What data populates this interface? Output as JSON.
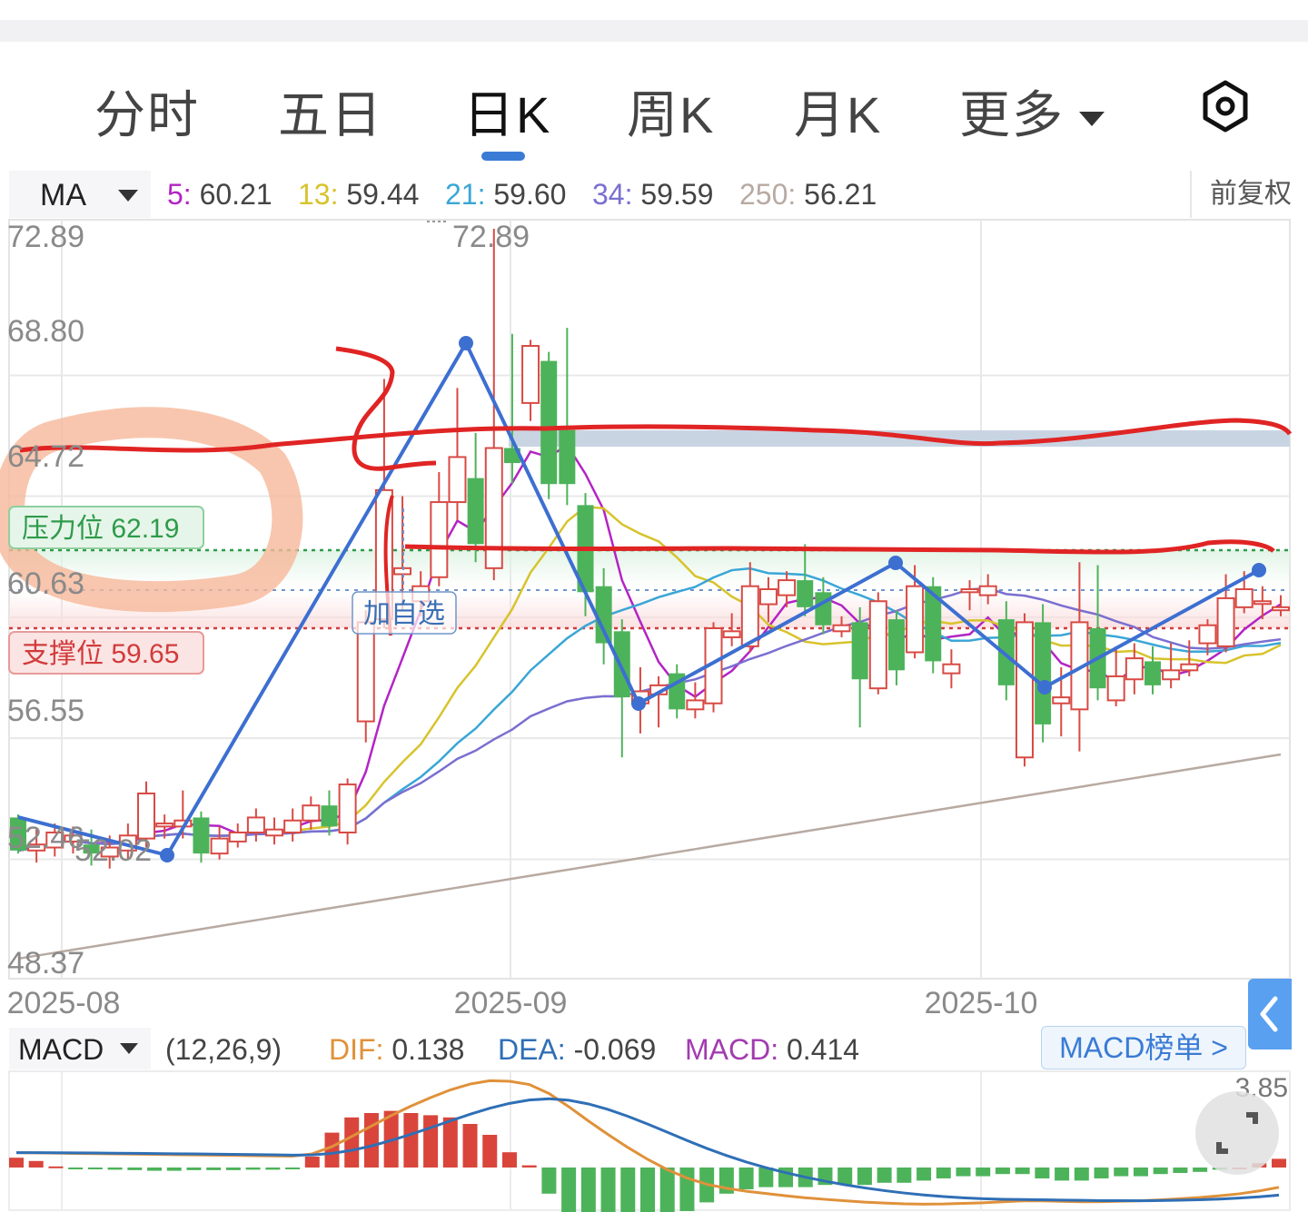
{
  "tabs": [
    {
      "label": "分时"
    },
    {
      "label": "五日"
    },
    {
      "label": "日K",
      "active": true
    },
    {
      "label": "周K"
    },
    {
      "label": "月K"
    },
    {
      "label": "更多"
    }
  ],
  "settings_icon": "hexagon-gear-icon",
  "ma_legend": {
    "label": "MA",
    "items": [
      {
        "key": "5",
        "value": "60.21",
        "color": "#b324c4"
      },
      {
        "key": "13",
        "value": "59.44",
        "color": "#d8c32c"
      },
      {
        "key": "21",
        "value": "59.60",
        "color": "#3aa6d6"
      },
      {
        "key": "34",
        "value": "59.59",
        "color": "#7a6fd0"
      },
      {
        "key": "250",
        "value": "56.21",
        "color": "#b8aaa2"
      }
    ],
    "adjust_label": "前复权"
  },
  "chart_data": {
    "type": "candlestick",
    "y_range": [
      48.37,
      72.89
    ],
    "y_ticks": [
      "72.89",
      "68.80",
      "64.72",
      "60.63",
      "56.55",
      "52.46",
      "48.37"
    ],
    "x_ticks": [
      "2025-08",
      "2025-09",
      "2025-10"
    ],
    "max_label": "72.89",
    "min_label": "52.02",
    "resistance": {
      "label": "压力位 62.19",
      "value": 62.19,
      "color": "#2e9b4a"
    },
    "support": {
      "label": "支撑位 59.65",
      "value": 59.65,
      "color": "#d23b3b"
    },
    "current_price": 60.63,
    "watchlist_label": "加自选",
    "candles": [
      [
        53.3,
        52.2,
        53.4,
        52.1
      ],
      [
        52.2,
        52.4,
        52.9,
        51.8
      ],
      [
        52.3,
        52.8,
        53.1,
        52.0
      ],
      [
        52.5,
        52.7,
        53.0,
        52.1
      ],
      [
        52.4,
        52.1,
        52.9,
        51.7
      ],
      [
        52.0,
        52.3,
        52.7,
        51.6
      ],
      [
        52.2,
        52.7,
        53.1,
        51.9
      ],
      [
        52.6,
        54.1,
        54.5,
        52.3
      ],
      [
        53.0,
        53.1,
        53.4,
        52.6
      ],
      [
        53.0,
        53.2,
        54.2,
        52.6
      ],
      [
        53.3,
        52.1,
        53.5,
        51.8
      ],
      [
        52.1,
        52.6,
        53.0,
        51.9
      ],
      [
        52.5,
        52.8,
        53.1,
        52.3
      ],
      [
        52.8,
        53.3,
        53.6,
        52.5
      ],
      [
        52.7,
        52.9,
        53.3,
        52.4
      ],
      [
        52.8,
        53.2,
        53.6,
        52.5
      ],
      [
        53.2,
        53.7,
        54.0,
        52.9
      ],
      [
        53.7,
        53.0,
        54.2,
        52.7
      ],
      [
        52.8,
        54.4,
        54.6,
        52.4
      ],
      [
        56.5,
        59.8,
        60.2,
        55.8
      ],
      [
        59.9,
        64.2,
        67.9,
        59.6
      ],
      [
        61.4,
        61.6,
        64.0,
        60.2
      ],
      [
        60.5,
        61.0,
        61.5,
        60.0
      ],
      [
        61.3,
        63.8,
        64.8,
        61.0
      ],
      [
        63.8,
        65.3,
        67.6,
        63.2
      ],
      [
        64.6,
        62.4,
        66.1,
        61.8
      ],
      [
        61.6,
        65.6,
        72.9,
        61.2
      ],
      [
        65.6,
        65.1,
        69.4,
        64.4
      ],
      [
        67.1,
        69.0,
        69.2,
        66.5
      ],
      [
        68.5,
        64.4,
        68.8,
        63.9
      ],
      [
        66.2,
        64.4,
        69.6,
        63.7
      ],
      [
        63.7,
        60.8,
        64.1,
        60.0
      ],
      [
        61.0,
        59.1,
        61.6,
        58.4
      ],
      [
        59.5,
        57.3,
        59.9,
        55.3
      ],
      [
        57.1,
        57.5,
        58.3,
        56.1
      ],
      [
        57.4,
        57.7,
        58.0,
        56.3
      ],
      [
        58.1,
        56.9,
        58.4,
        56.6
      ],
      [
        56.9,
        57.2,
        57.8,
        56.6
      ],
      [
        57.1,
        59.6,
        59.8,
        56.8
      ],
      [
        59.3,
        59.5,
        60.1,
        59.0
      ],
      [
        59.0,
        61.0,
        61.8,
        58.8
      ],
      [
        60.4,
        60.9,
        61.3,
        59.8
      ],
      [
        60.7,
        61.2,
        61.5,
        60.3
      ],
      [
        61.2,
        60.3,
        62.4,
        60.0
      ],
      [
        60.8,
        59.7,
        61.3,
        59.4
      ],
      [
        59.5,
        59.7,
        60.0,
        59.3
      ],
      [
        59.8,
        57.9,
        60.3,
        56.3
      ],
      [
        57.6,
        60.5,
        60.8,
        57.4
      ],
      [
        59.9,
        58.2,
        60.2,
        57.7
      ],
      [
        58.8,
        61.0,
        61.7,
        58.6
      ],
      [
        61.0,
        58.5,
        61.3,
        58.1
      ],
      [
        58.1,
        58.4,
        58.9,
        57.6
      ],
      [
        60.8,
        60.9,
        61.2,
        60.2
      ],
      [
        60.7,
        61.0,
        61.4,
        60.4
      ],
      [
        59.9,
        57.7,
        60.5,
        57.2
      ],
      [
        55.3,
        59.8,
        60.1,
        55.0
      ],
      [
        59.8,
        56.4,
        60.4,
        55.8
      ],
      [
        57.1,
        57.3,
        58.3,
        56.0
      ],
      [
        56.9,
        59.8,
        61.8,
        55.5
      ],
      [
        59.6,
        57.6,
        61.7,
        57.2
      ],
      [
        57.2,
        58.0,
        59.0,
        57.0
      ],
      [
        57.9,
        58.6,
        59.1,
        57.4
      ],
      [
        58.5,
        57.7,
        59.0,
        57.4
      ],
      [
        57.9,
        58.2,
        59.1,
        57.6
      ],
      [
        58.2,
        58.4,
        59.2,
        58.0
      ],
      [
        59.1,
        59.7,
        59.9,
        58.7
      ],
      [
        59.0,
        60.6,
        61.4,
        58.8
      ],
      [
        60.3,
        60.9,
        61.5,
        60.1
      ],
      [
        60.5,
        60.5,
        61.0,
        59.9
      ],
      [
        60.2,
        60.3,
        60.7,
        60.0
      ]
    ],
    "ma_series": [
      {
        "name": "5",
        "color": "#b324c4"
      },
      {
        "name": "13",
        "color": "#d8c32c"
      },
      {
        "name": "21",
        "color": "#3aa6d6"
      },
      {
        "name": "34",
        "color": "#7a6fd0"
      },
      {
        "name": "250",
        "color": "#b8aaa2"
      }
    ]
  },
  "macd_legend": {
    "label": "MACD",
    "params": "(12,26,9)",
    "items": [
      {
        "key": "DIF",
        "value": "0.138",
        "color": "#e0913a"
      },
      {
        "key": "DEA",
        "value": "-0.069",
        "color": "#2f6fb6"
      },
      {
        "key": "MACD",
        "value": "0.414",
        "color": "#a33bb0"
      }
    ],
    "rank_label": "MACD榜单 >",
    "max_label": "3.85"
  },
  "macd_data": {
    "type": "bar",
    "hist": [
      0.45,
      0.3,
      0.05,
      -0.05,
      -0.08,
      -0.1,
      -0.12,
      -0.15,
      -0.15,
      -0.12,
      -0.12,
      -0.12,
      -0.1,
      -0.1,
      -0.08,
      0.5,
      1.6,
      2.3,
      2.5,
      2.6,
      2.5,
      2.4,
      2.3,
      2.0,
      1.5,
      0.7,
      0.1,
      -1.2,
      -2.2,
      -2.6,
      -2.6,
      -2.6,
      -2.5,
      -2.3,
      -2.0,
      -1.6,
      -1.2,
      -1.0,
      -0.9,
      -0.9,
      -0.9,
      -0.8,
      -0.8,
      -0.8,
      -0.7,
      -0.7,
      -0.6,
      -0.5,
      -0.4,
      -0.4,
      -0.3,
      -0.3,
      -0.5,
      -0.6,
      -0.6,
      -0.5,
      -0.4,
      -0.4,
      -0.3,
      -0.25,
      -0.2,
      -0.1,
      0.0,
      0.2,
      0.4
    ],
    "colors": {
      "up": "#d9453b",
      "down": "#4db35a",
      "dif": "#e0913a",
      "dea": "#2f6fb6"
    }
  },
  "annotations": {
    "hand_drawn_color": "#e02424",
    "trend_line_color": "#3d6fd1",
    "highlight_color": "#f6b89a"
  }
}
